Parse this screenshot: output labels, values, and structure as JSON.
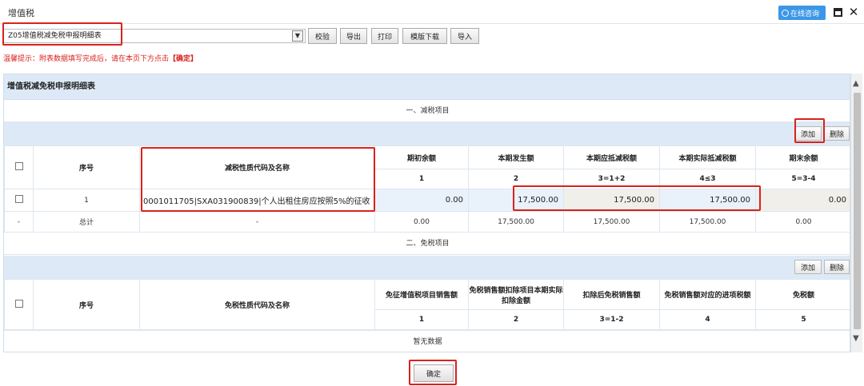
{
  "window": {
    "title": "增值税",
    "consult_label": "在线咨询"
  },
  "toolbar": {
    "selected_form": "Z05增值税减免税申报明细表",
    "buttons": [
      "校验",
      "导出",
      "打印",
      "模版下载",
      "导入"
    ]
  },
  "tip": {
    "prefix": "温馨提示：附表数据填写完成后，请在本页下方点击",
    "link": "【确定】"
  },
  "panel": {
    "title": "增值税减免税申报明细表"
  },
  "reduction": {
    "section_title": "一、减税项目",
    "add_label": "添加",
    "delete_label": "删除",
    "headers": [
      "序号",
      "减税性质代码及名称",
      "期初余额",
      "本期发生额",
      "本期应抵减税额",
      "本期实际抵减税额",
      "期末余额"
    ],
    "formula_row": [
      "1",
      "2",
      "3=1+2",
      "4≤3",
      "5=3-4"
    ],
    "rows": [
      {
        "seq": "1",
        "code": "0001011705|SXA031900839|个人出租住房应按照5%的征收",
        "opening": "0.00",
        "current": "17,500.00",
        "deductible": "17,500.00",
        "actual": "17,500.00",
        "closing": "0.00"
      }
    ],
    "total": {
      "check": "-",
      "seq": "总计",
      "code": "-",
      "opening": "0.00",
      "current": "17,500.00",
      "deductible": "17,500.00",
      "actual": "17,500.00",
      "closing": "0.00"
    }
  },
  "exemption": {
    "section_title": "二、免税项目",
    "add_label": "添加",
    "delete_label": "删除",
    "headers": [
      "序号",
      "免税性质代码及名称",
      "免征增值税项目销售额",
      "免税销售额扣除项目本期实际扣除金额",
      "扣除后免税销售额",
      "免税销售额对应的进项税额",
      "免税额"
    ],
    "formula_row": [
      "1",
      "2",
      "3=1-2",
      "4",
      "5"
    ],
    "empty_text": "暂无数据"
  },
  "confirm_label": "确定",
  "colors": {
    "highlight": "#d9221c",
    "header_bg": "#dde9f6",
    "accent": "#3c97e6"
  }
}
